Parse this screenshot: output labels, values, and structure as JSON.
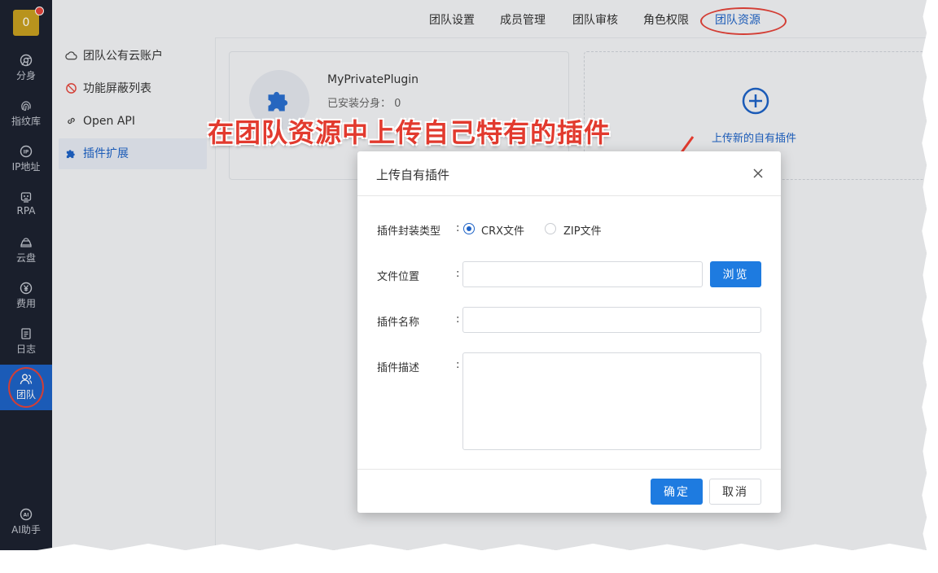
{
  "sidebar": {
    "logo": "0",
    "items": [
      {
        "label": "分身",
        "icon": "chrome-icon"
      },
      {
        "label": "指纹库",
        "icon": "fingerprint-icon"
      },
      {
        "label": "IP地址",
        "icon": "ip-icon"
      },
      {
        "label": "RPA",
        "icon": "robot-icon"
      },
      {
        "label": "云盘",
        "icon": "cloud-drive-icon"
      },
      {
        "label": "费用",
        "icon": "yen-icon"
      },
      {
        "label": "日志",
        "icon": "log-icon"
      },
      {
        "label": "团队",
        "icon": "team-icon",
        "active": true
      }
    ],
    "ai_label": "AI助手"
  },
  "topbar": {
    "tabs": [
      "团队设置",
      "成员管理",
      "团队审核",
      "角色权限",
      "团队资源"
    ],
    "active_tab": "团队资源"
  },
  "leftnav": {
    "items": [
      "团队公有云账户",
      "功能屏蔽列表",
      "Open API",
      "插件扩展"
    ],
    "active": "插件扩展"
  },
  "plugin_card": {
    "name": "MyPrivatePlugin",
    "installed": "已安装分身：",
    "installed_count": "0"
  },
  "upload_card": {
    "text": "上传新的自有插件"
  },
  "annotation": {
    "caption": "在团队资源中上传自己特有的插件"
  },
  "modal": {
    "title": "上传自有插件",
    "type_label": "插件封装类型",
    "type_options": [
      "CRX文件",
      "ZIP文件"
    ],
    "type_selected": "CRX文件",
    "file_label": "文件位置",
    "file_value": "",
    "browse_label": "浏览",
    "name_label": "插件名称",
    "name_value": "",
    "desc_label": "插件描述",
    "desc_value": "",
    "colon": ":",
    "ok_label": "确定",
    "cancel_label": "取消"
  },
  "colors": {
    "accent": "#1e63c7",
    "primary_button": "#1e7be0",
    "sidebar_bg": "#1d2230",
    "annotation_red": "#e23a2e"
  }
}
